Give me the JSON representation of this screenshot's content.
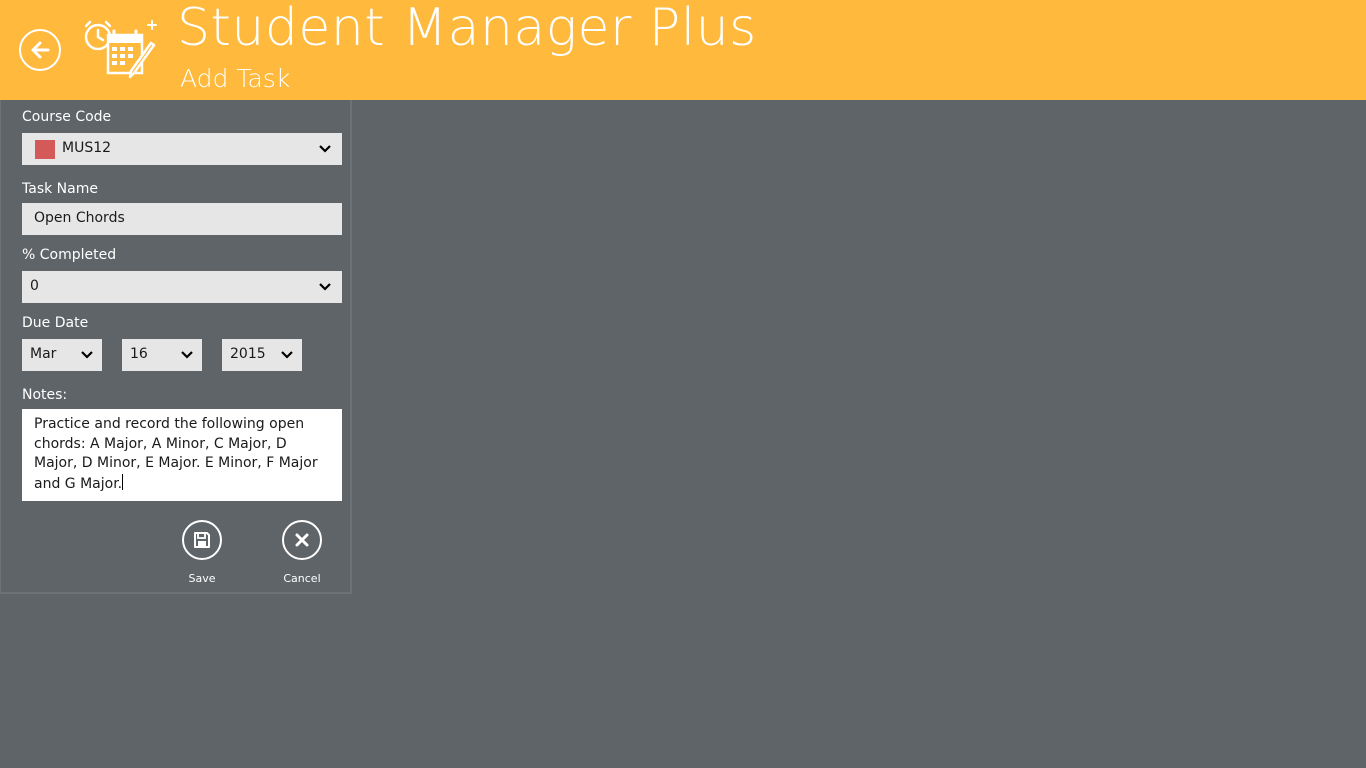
{
  "header": {
    "app_title": "Student Manager Plus",
    "page_subtitle": "Add Task",
    "accent_color": "#ffb93c"
  },
  "form": {
    "course_code": {
      "label": "Course Code",
      "value": "MUS12",
      "swatch_color": "#d45a5a"
    },
    "task_name": {
      "label": "Task Name",
      "value": "Open Chords"
    },
    "percent_completed": {
      "label": "% Completed",
      "value": "0"
    },
    "due_date": {
      "label": "Due Date",
      "month": "Mar",
      "day": "16",
      "year": "2015"
    },
    "notes": {
      "label": "Notes:",
      "value": "Practice and record the following open chords: A Major, A Minor, C Major, D Major, D Minor, E Major. E Minor, F Major and G Major."
    }
  },
  "actions": {
    "save_label": "Save",
    "cancel_label": "Cancel"
  },
  "icons": {
    "back": "back-arrow-icon",
    "logo": "clock-calendar-pencil-icon",
    "dropdown": "chevron-down-icon",
    "save": "floppy-disk-icon",
    "cancel": "close-icon"
  }
}
